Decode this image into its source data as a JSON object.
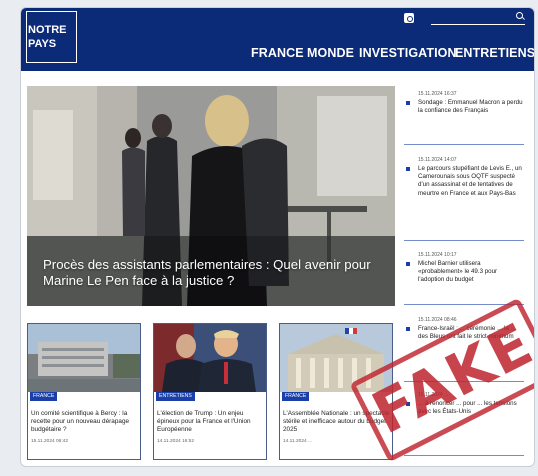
{
  "site": {
    "logo_line1": "NOTRE",
    "logo_line2": "PAYS"
  },
  "nav": [
    "FRANCE",
    "MONDE",
    "INVESTIGATION",
    "ENTRETIENS"
  ],
  "hero": {
    "title": "Procès des assistants parlementaires : Quel avenir pour Marine Le Pen face à la justice ?"
  },
  "sidebar": [
    {
      "date": "15.11.2024 16:37",
      "text": "Sondage : Emmanuel Macron a perdu la confiance des Français"
    },
    {
      "date": "15.11.2024 14:07",
      "text": "Le parcours stupéfiant de Levis E., un Camerounais sous OQTF suspecté d'un assassinat et de tentatives de meurtre en France et aux Pays-Bas"
    },
    {
      "date": "15.11.2024 10:17",
      "text": "Michel Barnier utilisera «probablement» le 49.3 pour l'adoption du budget"
    },
    {
      "date": "15.11.2024 08:46",
      "text": "France-Israël : ... cérémonie ... la ... des Bleus ont fait le strict minimum"
    },
    {
      "date": "15.11.2024 ...",
      "text": "... à renoncer ... pour ... les tensions avec les États-Unis"
    }
  ],
  "cards": [
    {
      "tag": "FRANCE",
      "title": "Un comité scientifique à Bercy : la recette pour un nouveau dérapage budgétaire ?",
      "date": "15.11.2024 06:42"
    },
    {
      "tag": "ENTRETIENS",
      "title": "L'élection de Trump : Un enjeu épineux pour la France et l'Union Européenne",
      "date": "14.11.2024 16:52"
    },
    {
      "tag": "FRANCE",
      "title": "L'Assemblée Nationale : un spectacle stérile et inefficace autour du budget 2025",
      "date": "14.11.2024 ..."
    }
  ],
  "stamp": {
    "text": "FAKE",
    "color": "#be232d"
  },
  "colors": {
    "brand": "#0b2a78",
    "accent": "#1a3fa8"
  },
  "icons": {
    "social": "instagram-icon",
    "search": "search-icon"
  }
}
